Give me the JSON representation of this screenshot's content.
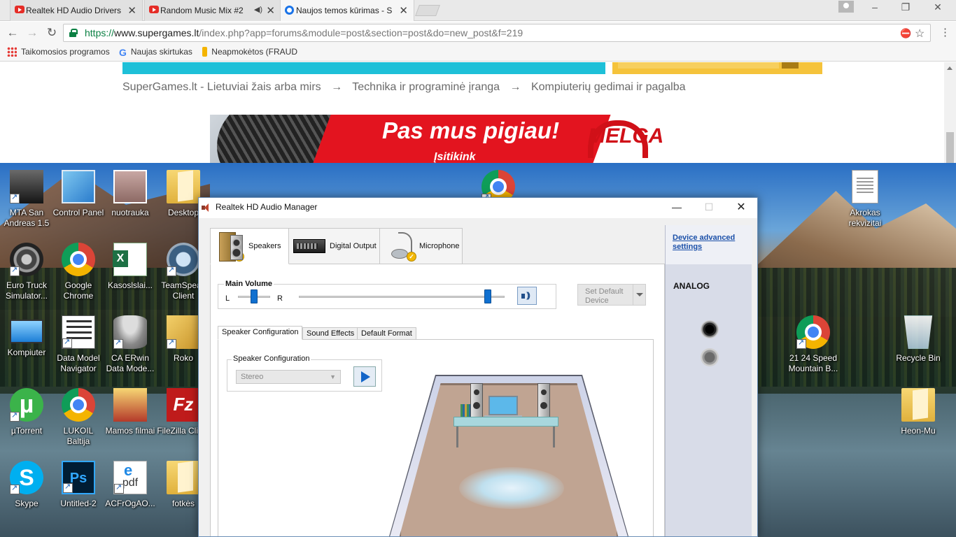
{
  "browser": {
    "tabs": [
      {
        "title": "Realtek HD Audio Drivers",
        "icon": "youtube-icon",
        "audio": false
      },
      {
        "title": "Random Music Mix #2",
        "icon": "youtube-icon",
        "audio": true
      },
      {
        "title": "Naujos temos kūrimas - S",
        "icon": "chrome-icon",
        "audio": false
      }
    ],
    "tab_close_glyph": "✕",
    "window_controls": {
      "minimize": "–",
      "restore": "❐",
      "close": "✕"
    },
    "nav": {
      "back": "←",
      "forward": "→",
      "reload": "↻"
    },
    "address": {
      "scheme": "https://",
      "host": "www.supergames.lt",
      "path": "/index.php?app=forums&module=post&section=post&do=new_post&f=219"
    },
    "omnibox_icons": {
      "extension": "⛔",
      "star": "☆"
    },
    "menu_glyph": "⋮",
    "bookmarks": [
      {
        "label": "Taikomosios programos",
        "icon": "apps-icon"
      },
      {
        "label": "Naujas skirtukas",
        "icon": "google-icon",
        "glyph": "G"
      },
      {
        "label": "Neapmokėtos (FRAUD",
        "icon": "bookmark-icon"
      }
    ]
  },
  "page": {
    "breadcrumb": [
      "SuperGames.lt - Lietuviai žais arba mirs",
      "→",
      "Technika ir programinė įranga",
      "→",
      "Kompiuterių gedimai ir pagalba"
    ],
    "banner": {
      "headline": "Pas mus pigiau!",
      "subline": "Įsitikink",
      "brand": "MELGA"
    },
    "colors": {
      "accent": "#1ec0d8",
      "search_bar": "#f5c33b",
      "banner_red": "#e3141f"
    }
  },
  "desktop": {
    "icons": [
      {
        "label": "MTA San Andreas 1.5",
        "icon": "mta-icon"
      },
      {
        "label": "Control Panel",
        "icon": "control-panel-icon"
      },
      {
        "label": "nuotrauka",
        "icon": "photo-icon"
      },
      {
        "label": "Desktop",
        "icon": "folder-icon"
      },
      {
        "label": "Euro Truck Simulator...",
        "icon": "wheel-icon"
      },
      {
        "label": "Google Chrome",
        "icon": "chrome-icon"
      },
      {
        "label": "Kasoslslai...",
        "icon": "excel-icon"
      },
      {
        "label": "TeamSpeak Client",
        "icon": "teamspeak-icon"
      },
      {
        "label": "Kompiuter",
        "icon": "computer-icon"
      },
      {
        "label": "Data Model Navigator",
        "icon": "data-model-icon"
      },
      {
        "label": "CA ERwin Data Mode...",
        "icon": "database-icon"
      },
      {
        "label": "Roko",
        "icon": "folder-icon"
      },
      {
        "label": "µTorrent",
        "icon": "utorrent-icon"
      },
      {
        "label": "LUKOIL Baltija",
        "icon": "chrome-icon"
      },
      {
        "label": "Mamos filmai",
        "icon": "folder-icon"
      },
      {
        "label": "FileZilla Client",
        "icon": "filezilla-icon"
      },
      {
        "label": "Skype",
        "icon": "skype-icon"
      },
      {
        "label": "Untitled-2",
        "icon": "photoshop-icon"
      },
      {
        "label": "ACFrOgAO...",
        "icon": "pdf-icon"
      },
      {
        "label": "fotkės",
        "icon": "folder-icon"
      },
      {
        "label": "Akrokas rekvizitai",
        "icon": "document-icon"
      },
      {
        "label": "21 24 Speed Mountain B...",
        "icon": "chrome-icon"
      },
      {
        "label": "Recycle Bin",
        "icon": "recycle-bin-icon"
      },
      {
        "label": "Heon-Mu",
        "icon": "folder-icon"
      }
    ]
  },
  "realtek": {
    "title": "Realtek HD Audio Manager",
    "window_controls": {
      "minimize": "—",
      "maximize": "☐",
      "close": "✕"
    },
    "device_tabs": [
      {
        "label": "Speakers",
        "icon": "speakers-icon",
        "active": true
      },
      {
        "label": "Digital Output",
        "icon": "digital-output-icon",
        "active": false
      },
      {
        "label": "Microphone",
        "icon": "microphone-icon",
        "active": false
      }
    ],
    "check_glyph": "✓",
    "main_volume": {
      "label": "Main Volume",
      "left_label": "L",
      "right_label": "R",
      "balance_fraction": 0.5,
      "volume_fraction": 0.92
    },
    "set_default": {
      "label": "Set Default Device",
      "enabled": false
    },
    "sub_tabs": [
      "Speaker Configuration",
      "Sound Effects",
      "Default Format"
    ],
    "speaker_configuration": {
      "group_label": "Speaker Configuration",
      "selected": "Stereo",
      "dropdown_glyph": "▼"
    },
    "sidebar": {
      "link": "Device advanced settings",
      "section": "ANALOG",
      "jacks": [
        {
          "name": "black",
          "color": "#000000"
        },
        {
          "name": "grey",
          "color": "#8a8a8a"
        }
      ]
    }
  }
}
